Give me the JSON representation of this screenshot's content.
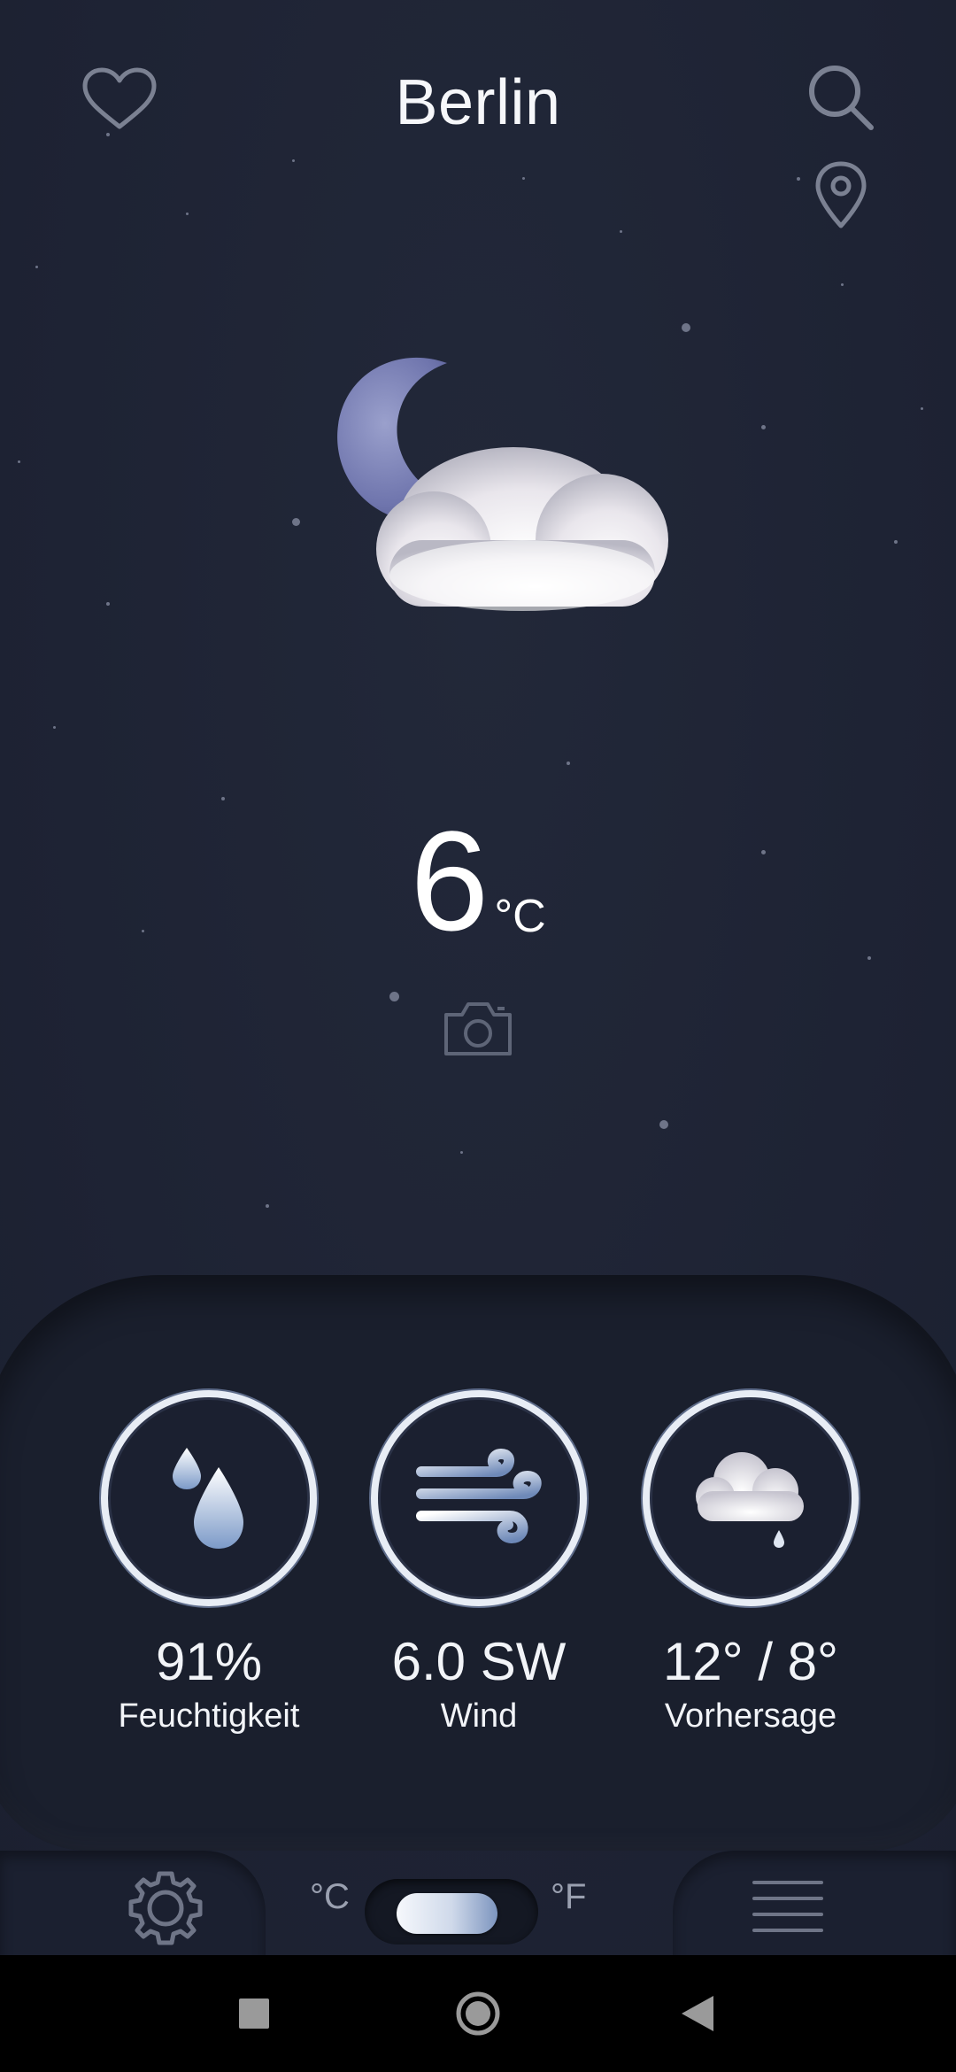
{
  "header": {
    "city": "Berlin",
    "favorite_icon": "heart-outline-icon",
    "search_icon": "search-icon",
    "location_icon": "location-pin-icon"
  },
  "current": {
    "condition_icon": "moon-cloud-icon",
    "temperature": "6",
    "unit": "°C",
    "camera_icon": "camera-icon"
  },
  "stats": [
    {
      "icon": "water-drops-icon",
      "value": "91%",
      "label": "Feuchtigkeit"
    },
    {
      "icon": "wind-icon",
      "value": "6.0 SW",
      "label": "Wind"
    },
    {
      "icon": "cloud-drizzle-icon",
      "value": "12° / 8°",
      "label": "Vorhersage"
    }
  ],
  "bottom": {
    "settings_icon": "gear-icon",
    "unit_c": "°C",
    "unit_f": "°F",
    "unit_selected": "°C",
    "menu_icon": "hamburger-menu-icon"
  },
  "system_nav": [
    "recents-square-icon",
    "home-circle-icon",
    "back-triangle-icon"
  ],
  "colors": {
    "background": "#1e2334",
    "panel": "#1a1f2d",
    "text": "#ffffff",
    "ring": "#e8edf5",
    "icon_muted": "#7b8192"
  }
}
